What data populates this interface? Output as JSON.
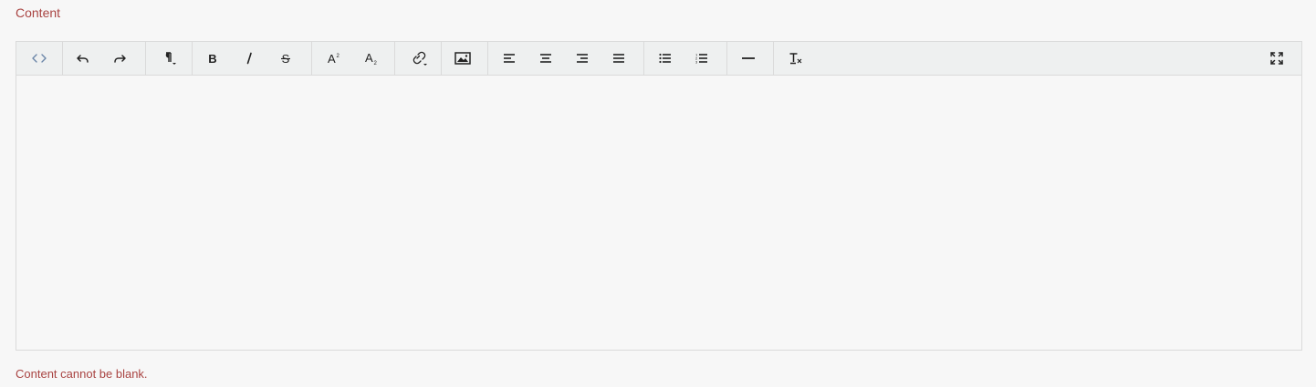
{
  "field": {
    "label": "Content",
    "error": "Content cannot be blank.",
    "label_color": "#a94442"
  },
  "editor": {
    "content": "",
    "toolbar": [
      {
        "name": "code-view-button",
        "icon": "code-view-icon",
        "tooltip": "Code View"
      },
      {
        "name": "undo-button",
        "icon": "undo-icon",
        "tooltip": "Undo"
      },
      {
        "name": "redo-button",
        "icon": "redo-icon",
        "tooltip": "Redo"
      },
      {
        "name": "paragraph-style-dropdown",
        "icon": "paragraph-icon",
        "tooltip": "Paragraph"
      },
      {
        "name": "bold-button",
        "icon": "bold-icon",
        "tooltip": "Bold"
      },
      {
        "name": "italic-button",
        "icon": "italic-icon",
        "tooltip": "Italic"
      },
      {
        "name": "strikethrough-button",
        "icon": "strikethrough-icon",
        "tooltip": "Strikethrough"
      },
      {
        "name": "superscript-button",
        "icon": "superscript-icon",
        "tooltip": "Superscript"
      },
      {
        "name": "subscript-button",
        "icon": "subscript-icon",
        "tooltip": "Subscript"
      },
      {
        "name": "link-dropdown",
        "icon": "link-icon",
        "tooltip": "Link"
      },
      {
        "name": "image-button",
        "icon": "image-icon",
        "tooltip": "Image"
      },
      {
        "name": "align-left-button",
        "icon": "align-left-icon",
        "tooltip": "Align Left"
      },
      {
        "name": "align-center-button",
        "icon": "align-center-icon",
        "tooltip": "Align Center"
      },
      {
        "name": "align-right-button",
        "icon": "align-right-icon",
        "tooltip": "Align Right"
      },
      {
        "name": "align-justify-button",
        "icon": "align-justify-icon",
        "tooltip": "Justify"
      },
      {
        "name": "unordered-list-button",
        "icon": "unordered-list-icon",
        "tooltip": "Unordered List"
      },
      {
        "name": "ordered-list-button",
        "icon": "ordered-list-icon",
        "tooltip": "Ordered List"
      },
      {
        "name": "horizontal-rule-button",
        "icon": "horizontal-rule-icon",
        "tooltip": "Horizontal Line"
      },
      {
        "name": "clear-formatting-button",
        "icon": "clear-formatting-icon",
        "tooltip": "Clear Formatting"
      },
      {
        "name": "fullscreen-button",
        "icon": "fullscreen-icon",
        "tooltip": "Fullscreen"
      }
    ]
  }
}
